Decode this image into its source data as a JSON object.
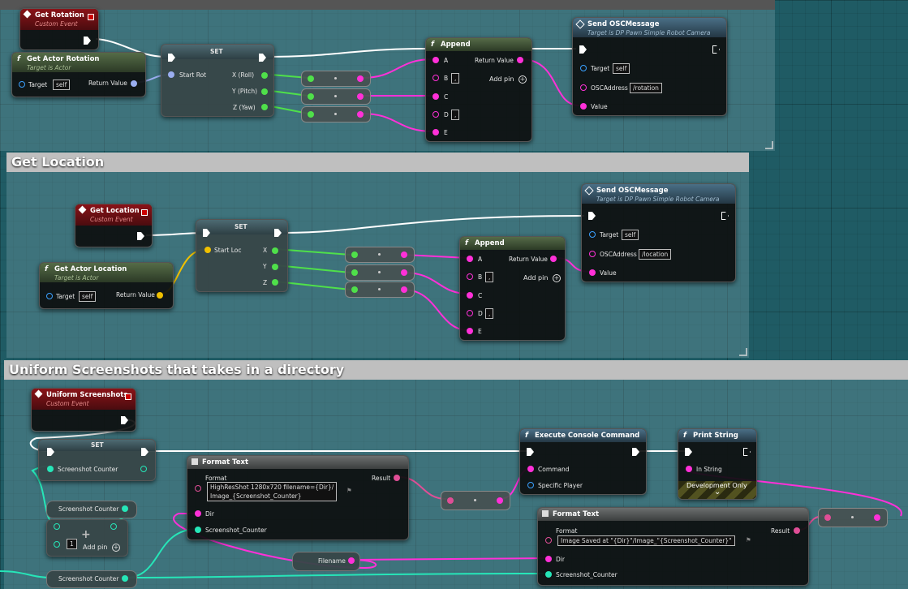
{
  "colors": {
    "exec": "#ffffff",
    "rotator": "#9aaef0",
    "object": "#3aa0ff",
    "vector": "#f0c000",
    "float": "#4fe04a",
    "string": "#ff30d8",
    "integer": "#26e6b8",
    "text": "#e04e96",
    "event_header": "#8a1318"
  },
  "comments": [
    {
      "title": ""
    },
    {
      "title": "Get Location"
    },
    {
      "title": "Uniform Screenshots that takes in a directory"
    }
  ],
  "rot": {
    "event": {
      "title": "Get Rotation",
      "subtitle": "Custom Event"
    },
    "get_actor": {
      "title": "Get Actor Rotation",
      "subtitle": "Target is Actor",
      "target_label": "Target",
      "target_value": "self",
      "return_label": "Return Value"
    },
    "set": {
      "title": "SET",
      "start_label": "Start Rot",
      "pins": [
        "X (Roll)",
        "Y (Pitch)",
        "Z (Yaw)"
      ]
    },
    "append": {
      "title": "Append",
      "pins": [
        "A",
        "B",
        "C",
        "D",
        "E"
      ],
      "b_value": ",",
      "d_value": ",",
      "return_label": "Return Value",
      "add_pin": "Add pin"
    },
    "send": {
      "title": "Send OSCMessage",
      "subtitle": "Target is DP Pawn Simple Robot Camera",
      "target_label": "Target",
      "target_value": "self",
      "addr_label": "OSCAddress",
      "addr_value": "/rotation",
      "value_label": "Value"
    }
  },
  "loc": {
    "event": {
      "title": "Get Location",
      "subtitle": "Custom Event"
    },
    "get_actor": {
      "title": "Get Actor Location",
      "subtitle": "Target is Actor",
      "target_label": "Target",
      "target_value": "self",
      "return_label": "Return Value"
    },
    "set": {
      "title": "SET",
      "start_label": "Start Loc",
      "pins": [
        "X",
        "Y",
        "Z"
      ]
    },
    "append": {
      "title": "Append",
      "pins": [
        "A",
        "B",
        "C",
        "D",
        "E"
      ],
      "b_value": ",",
      "d_value": ",",
      "return_label": "Return Value",
      "add_pin": "Add pin"
    },
    "send": {
      "title": "Send OSCMessage",
      "subtitle": "Target is DP Pawn Simple Robot Camera",
      "target_label": "Target",
      "target_value": "self",
      "addr_label": "OSCAddress",
      "addr_value": "/location",
      "value_label": "Value"
    }
  },
  "shot": {
    "event": {
      "title": "Uniform Screenshots",
      "subtitle": "Custom Event"
    },
    "set": {
      "title": "SET",
      "var_label": "Screenshot Counter"
    },
    "counter_get1": "Screenshot Counter",
    "counter_get2": "Screenshot Counter",
    "add": {
      "value": "1",
      "add_pin": "Add pin"
    },
    "format1": {
      "title": "Format Text",
      "format_label": "Format",
      "format_value_line1": "HighResShot 1280x720 filename={Dir}/",
      "format_value_line2": "Image_{Screenshot_Counter}",
      "result_label": "Result",
      "dir_label": "Dir",
      "counter_label": "Screenshot_Counter"
    },
    "exec_cmd": {
      "title": "Execute Console Command",
      "command_label": "Command",
      "player_label": "Specific Player"
    },
    "print": {
      "title": "Print String",
      "in_label": "In String",
      "dev_only": "Development Only",
      "chevron": "⌄"
    },
    "format2": {
      "title": "Format Text",
      "format_label": "Format",
      "format_value": "Image Saved at \"{Dir}\"/Image_\"{Screenshot_Counter}\"",
      "result_label": "Result",
      "dir_label": "Dir",
      "counter_label": "Screenshot_Counter"
    },
    "filename": "Filename"
  }
}
